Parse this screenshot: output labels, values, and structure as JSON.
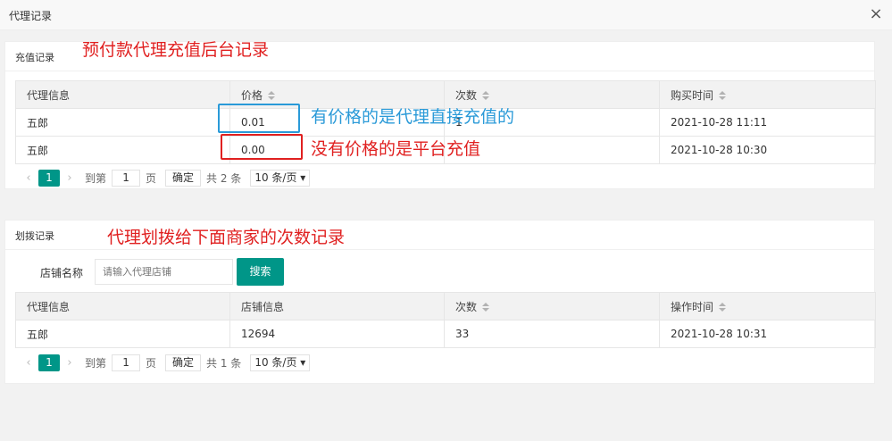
{
  "window": {
    "title": "代理记录",
    "close_glyph": "×"
  },
  "recharge": {
    "header": "充值记录",
    "annotation_title": "预付款代理充值后台记录",
    "annotation_price": "有价格的是代理直接充值的",
    "annotation_no_price": "没有价格的是平台充值",
    "columns": [
      "代理信息",
      "价格",
      "次数",
      "购买时间"
    ],
    "rows": [
      [
        "五郎",
        "0.01",
        "1",
        "2021-10-28 11:11"
      ],
      [
        "五郎",
        "0.00",
        "",
        "2021-10-28 10:30"
      ]
    ],
    "pager": {
      "prev": "‹",
      "next": "›",
      "current": "1",
      "goto_label": "到第",
      "goto_value": "1",
      "page_label": "页",
      "confirm": "确定",
      "total": "共 2 条",
      "per_page": "10 条/页"
    }
  },
  "transfer": {
    "header": "划拨记录",
    "annotation_title": "代理划拨给下面商家的次数记录",
    "search_label": "店铺名称",
    "search_placeholder": "请输入代理店铺",
    "search_button": "搜索",
    "columns": [
      "代理信息",
      "店铺信息",
      "次数",
      "操作时间"
    ],
    "rows": [
      [
        "五郎",
        "12694",
        "33",
        "2021-10-28 10:31"
      ]
    ],
    "pager": {
      "prev": "‹",
      "next": "›",
      "current": "1",
      "goto_label": "到第",
      "goto_value": "1",
      "page_label": "页",
      "confirm": "确定",
      "total": "共 1 条",
      "per_page": "10 条/页"
    }
  },
  "colors": {
    "accent": "#009688",
    "annotation_red": "#e02020",
    "annotation_blue": "#2a9ad8"
  }
}
